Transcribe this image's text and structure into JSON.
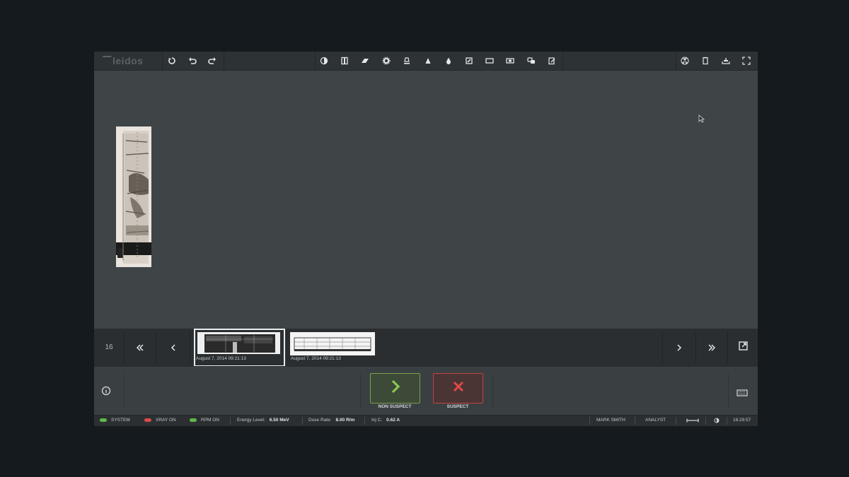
{
  "app": {
    "logo_text": "leidos"
  },
  "toolbar": {
    "left_icons": [
      "rotate-icon",
      "undo-icon",
      "redo-icon"
    ],
    "center_icons": [
      "contrast-icon",
      "columns-icon",
      "eraser-icon",
      "gear-icon",
      "lamp-icon",
      "triangle-icon",
      "drop-icon",
      "edit-frame-icon",
      "rectangle-icon",
      "region-icon",
      "comment-icon",
      "note-icon"
    ],
    "right_icons": [
      "radiation-icon",
      "clipboard-icon",
      "tray-icon",
      "fullscreen-icon"
    ]
  },
  "strip": {
    "count": "16",
    "first_icon": "double-chevron-left-icon",
    "prev_icon": "chevron-left-icon",
    "next_icon": "chevron-right-icon",
    "last_icon": "double-chevron-right-icon",
    "popout_icon": "popout-icon",
    "thumbnails": [
      {
        "date": "August 7, 2014   09:21:13",
        "selected": true
      },
      {
        "date": "August 7, 2014   09:21:13",
        "selected": false
      }
    ]
  },
  "decision": {
    "info_icon": "info-icon",
    "keyboard_icon": "keyboard-icon",
    "non_suspect_label": "NON SUSPECT",
    "suspect_label": "SUSPECT",
    "non_suspect_color": "#7fb24a",
    "suspect_color": "#d64040"
  },
  "status": {
    "system": {
      "label": "SYSTEM",
      "color": "#5fb84a"
    },
    "xray": {
      "label": "XRAY ON",
      "color": "#d94a4a"
    },
    "rpm": {
      "label": "RPM ON",
      "color": "#5fb84a"
    },
    "energy_label": "Energy Level:",
    "energy_value": "6.50  MeV",
    "dose_label": "Dose Rate:",
    "dose_value": "8.00  R/m",
    "inj_label": "Inj C:",
    "inj_value": "0.62  A",
    "user": "MARK SMITH",
    "role": "ANALYST",
    "clock": "16:29:57"
  }
}
